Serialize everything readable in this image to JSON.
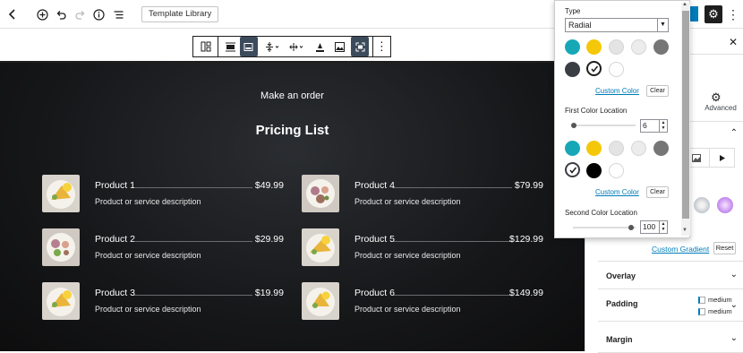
{
  "colors": {
    "accent": "#007cba",
    "teal": "#17a8b8",
    "yellow": "#f4c809",
    "light_gray": "#e4e4e4",
    "lighter_gray": "#ececec",
    "mid_gray": "#767676",
    "dark": "#3a3d44",
    "black": "#000000",
    "white": "#ffffff"
  },
  "topbar": {
    "template_library": "Template Library"
  },
  "block_toolbar": {
    "icons": [
      "block-type-icon",
      "align-icon",
      "full-width-icon",
      "vertical-align-icon",
      "justify-icon",
      "text-color-icon",
      "background-image-icon",
      "fullscreen-icon",
      "more-options-icon"
    ]
  },
  "canvas": {
    "subtitle": "Make an order",
    "title": "Pricing List",
    "products": [
      {
        "name": "Product 1",
        "price": "$49.99",
        "description": "Product or service description"
      },
      {
        "name": "Product 4",
        "price": "$79.99",
        "description": "Product or service description"
      },
      {
        "name": "Product 2",
        "price": "$29.99",
        "description": "Product or service description"
      },
      {
        "name": "Product 5",
        "price": "$129.99",
        "description": "Product or service description"
      },
      {
        "name": "Product 3",
        "price": "$19.99",
        "description": "Product or service description"
      },
      {
        "name": "Product 6",
        "price": "$149.99",
        "description": "Product or service description"
      }
    ]
  },
  "popover": {
    "type_label": "Type",
    "type_value": "Radial",
    "custom_color_1": "Custom Color",
    "clear_1": "Clear",
    "first_location_label": "First Color Location",
    "first_location_value": "6",
    "custom_color_2": "Custom Color",
    "clear_2": "Clear",
    "second_location_label": "Second Color Location",
    "second_location_value": "100"
  },
  "sidebar": {
    "advanced_tab": "Advanced",
    "custom_gradient": "Custom Gradient",
    "reset": "Reset",
    "overlay": "Overlay",
    "padding": "Padding",
    "padding_top": "medium",
    "padding_bottom": "medium",
    "margin": "Margin"
  }
}
